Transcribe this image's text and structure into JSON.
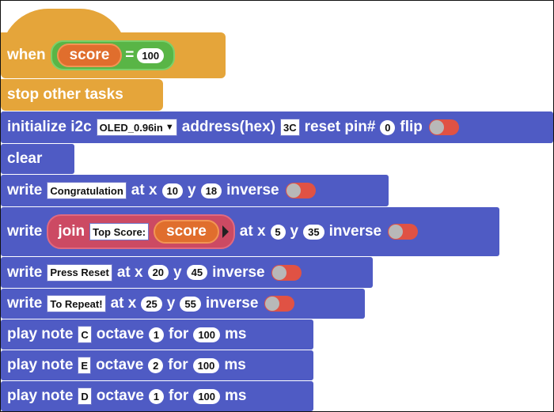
{
  "hat": {
    "when": "when",
    "variable": "score",
    "operator": "=",
    "value": "100"
  },
  "stop": "stop other tasks",
  "init": {
    "label": "initialize i2c",
    "display": "OLED_0.96in",
    "address_label": "address(hex)",
    "address": "3C",
    "reset_label": "reset pin#",
    "reset_pin": "0",
    "flip_label": "flip"
  },
  "clear": "clear",
  "write1": {
    "kw": "write",
    "text": "Congratulation",
    "atx": "at x",
    "x": "10",
    "y_label": "y",
    "y": "18",
    "inverse": "inverse"
  },
  "write2": {
    "kw": "write",
    "join": "join",
    "text": "Top Score:",
    "variable": "score",
    "atx": "at x",
    "x": "5",
    "y_label": "y",
    "y": "35",
    "inverse": "inverse"
  },
  "write3": {
    "kw": "write",
    "text": "Press Reset",
    "atx": "at x",
    "x": "20",
    "y_label": "y",
    "y": "45",
    "inverse": "inverse"
  },
  "write4": {
    "kw": "write",
    "text": "To Repeat!",
    "atx": "at x",
    "x": "25",
    "y_label": "y",
    "y": "55",
    "inverse": "inverse"
  },
  "notes": [
    {
      "play": "play note",
      "note": "C",
      "octave_label": "octave",
      "octave": "1",
      "for": "for",
      "duration": "100",
      "ms": "ms"
    },
    {
      "play": "play note",
      "note": "E",
      "octave_label": "octave",
      "octave": "2",
      "for": "for",
      "duration": "100",
      "ms": "ms"
    },
    {
      "play": "play note",
      "note": "D",
      "octave_label": "octave",
      "octave": "1",
      "for": "for",
      "duration": "100",
      "ms": "ms"
    }
  ],
  "colors": {
    "event_block": "#e5a53a",
    "command_block": "#4f5bc4",
    "variable_reporter": "#e06e2d",
    "compare_block": "#59b546",
    "join_block": "#cc4a63",
    "toggle_off": "#e05244"
  }
}
